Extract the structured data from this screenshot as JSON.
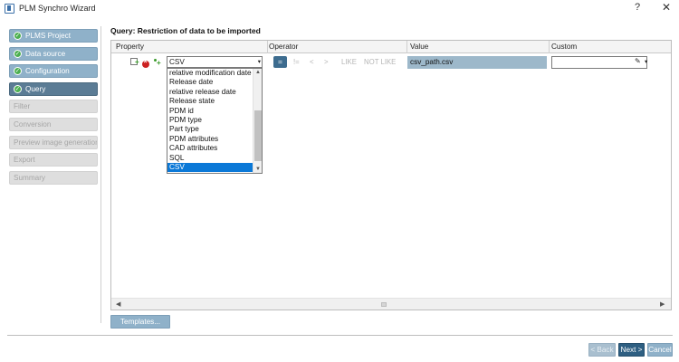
{
  "window": {
    "title": "PLM Synchro Wizard",
    "help_label": "?",
    "close_label": "✕"
  },
  "sidebar": {
    "steps": [
      {
        "label": "PLMS Project",
        "state": "done"
      },
      {
        "label": "Data source",
        "state": "done"
      },
      {
        "label": "Configuration",
        "state": "done"
      },
      {
        "label": "Query",
        "state": "active"
      },
      {
        "label": "Filter",
        "state": "disabled"
      },
      {
        "label": "Conversion",
        "state": "disabled"
      },
      {
        "label": "Preview image generation",
        "state": "disabled"
      },
      {
        "label": "Export",
        "state": "disabled"
      },
      {
        "label": "Summary",
        "state": "disabled"
      }
    ],
    "check_glyph": "✓"
  },
  "query": {
    "title": "Query: Restriction of data to be imported",
    "columns": {
      "property": "Property",
      "operator": "Operator",
      "value": "Value",
      "custom": "Custom"
    },
    "row": {
      "property_selected": "CSV",
      "value": "csv_path.csv",
      "custom": ""
    },
    "operators": [
      "=",
      "!=",
      "<",
      ">",
      "LIKE",
      "NOT LIKE"
    ],
    "active_operator": "=",
    "property_options": [
      "relative modification date",
      "Release date",
      "relative release date",
      "Release state",
      "PDM id",
      "PDM type",
      "Part type",
      "PDM attributes",
      "CAD attributes",
      "SQL",
      "CSV"
    ],
    "selected_option": "CSV"
  },
  "footer": {
    "templates_label": "Templates...",
    "back_label": "< Back",
    "next_label": "Next >",
    "cancel_label": "Cancel"
  },
  "icons": {
    "dropdown_arrow": "▾",
    "scroll_up": "▲",
    "scroll_down": "▼",
    "scroll_left": "◀",
    "scroll_right": "▶",
    "pencil": "✎"
  },
  "colors": {
    "accent_done": "#8fb1c9",
    "accent_active": "#5b7c95",
    "primary_button": "#2e5f82",
    "selection": "#0a78d7",
    "value_highlight": "#9db8ca"
  }
}
